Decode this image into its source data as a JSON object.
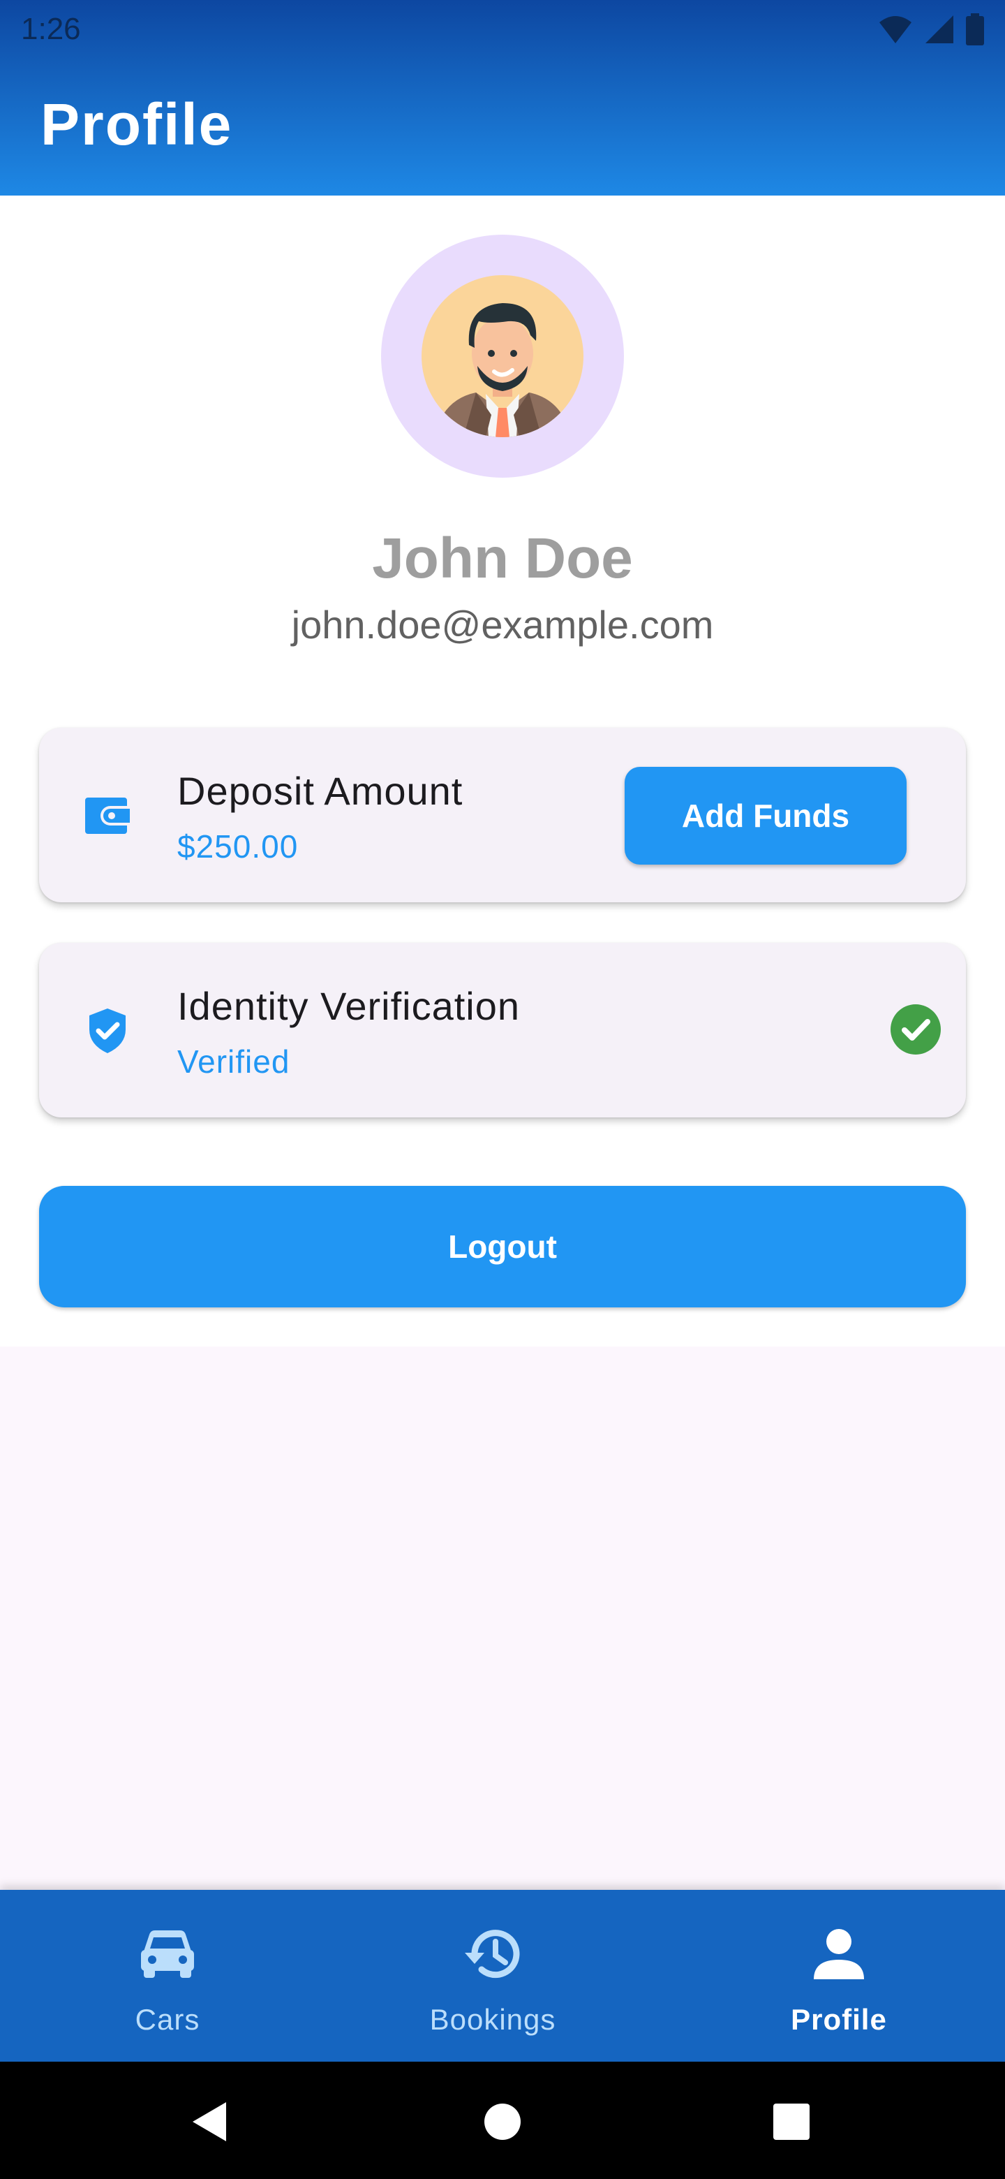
{
  "status_bar": {
    "time": "1:26",
    "icons": [
      "wifi-icon",
      "signal-icon",
      "battery-icon"
    ]
  },
  "app_bar": {
    "title": "Profile"
  },
  "profile": {
    "name": "John Doe",
    "email": "john.doe@example.com"
  },
  "deposit_card": {
    "icon": "wallet-icon",
    "title": "Deposit Amount",
    "amount": "$250.00",
    "button_label": "Add Funds"
  },
  "identity_card": {
    "icon": "verified-shield-icon",
    "title": "Identity Verification",
    "status": "Verified",
    "status_icon": "check-circle-icon"
  },
  "logout_label": "Logout",
  "bottom_nav": {
    "items": [
      {
        "label": "Cars",
        "icon": "car-icon",
        "active": false
      },
      {
        "label": "Bookings",
        "icon": "history-icon",
        "active": false
      },
      {
        "label": "Profile",
        "icon": "person-icon",
        "active": true
      }
    ]
  },
  "colors": {
    "primary": "#2196f3",
    "app_bar_dark": "#0d47a1",
    "nav_background": "#1565c0",
    "avatar_ring": "#e9dcfd",
    "success": "#43a047"
  }
}
